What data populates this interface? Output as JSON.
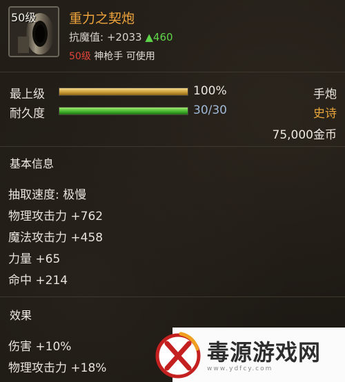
{
  "item": {
    "level_badge": "50级",
    "name": "重力之契炮",
    "stat_label": "抗魔值:",
    "stat_value": "+2033",
    "stat_increase": "▲460",
    "req_level": "50级",
    "req_class": "神枪手 可使用"
  },
  "bars": [
    {
      "label": "最上级",
      "text": "100%",
      "fraction": 1.0,
      "color": "gold"
    },
    {
      "label": "耐久度",
      "text": "30/30",
      "fraction": 1.0,
      "color": "green"
    }
  ],
  "item_type": "手炮",
  "rarity": "史诗",
  "price": "75,000金币",
  "basic_info": {
    "title": "基本信息",
    "attrs": [
      "抽取速度: 极慢",
      "物理攻击力 +762",
      "魔法攻击力 +458",
      "力量 +65",
      "命中 +214"
    ]
  },
  "effects": {
    "title": "效果",
    "attrs": [
      "伤害 +10%",
      "物理攻击力 +18%"
    ]
  },
  "watermark": {
    "text": "毒源游戏网",
    "url": "www.ydfcy.com"
  },
  "colors": {
    "item_name": "#f0a53c",
    "rarity": "#e7a43a",
    "stat_increase": "#5ed44a",
    "req_level": "#e0443a"
  }
}
